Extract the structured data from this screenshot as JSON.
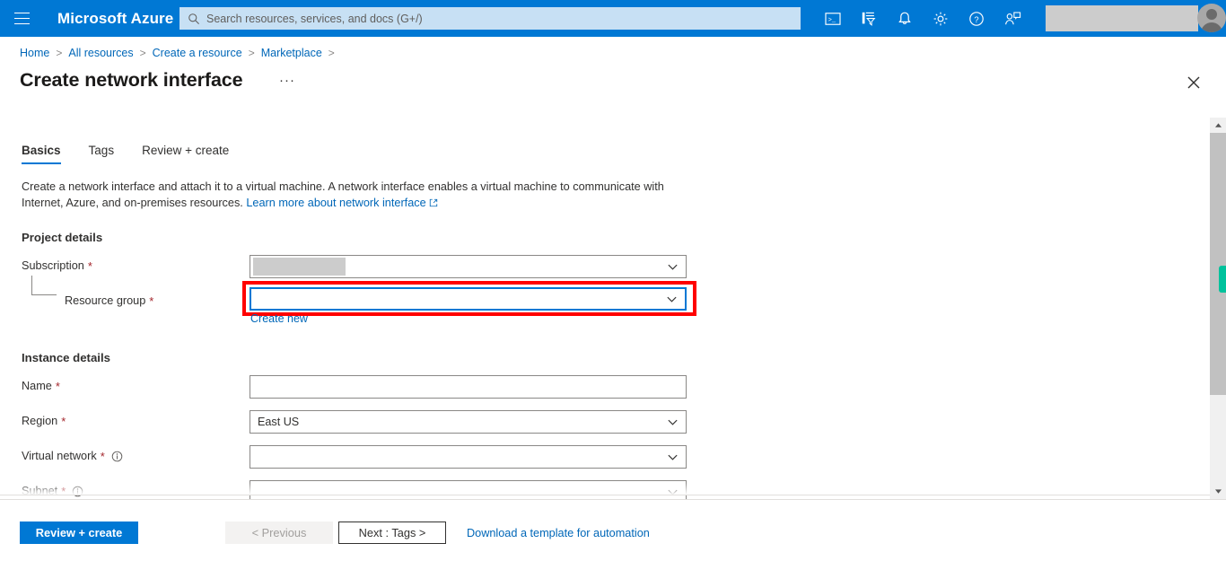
{
  "topbar": {
    "menu_icon": "hamburger-menu-icon",
    "brand": "Microsoft Azure",
    "search": {
      "placeholder": "Search resources, services, and docs (G+/)",
      "value": "",
      "icon": "search-icon"
    },
    "icons": [
      {
        "name": "cloud-shell-icon",
        "label": "Cloud Shell"
      },
      {
        "name": "directories-subscriptions-icon",
        "label": "Directories + subscriptions"
      },
      {
        "name": "notifications-bell-icon",
        "label": "Notifications"
      },
      {
        "name": "settings-gear-icon",
        "label": "Settings"
      },
      {
        "name": "help-question-icon",
        "label": "Help"
      },
      {
        "name": "feedback-person-icon",
        "label": "Feedback"
      }
    ],
    "account_redacted": "",
    "avatar": "user-avatar"
  },
  "breadcrumb": {
    "items": [
      "Home",
      "All resources",
      "Create a resource",
      "Marketplace"
    ],
    "separator": ">"
  },
  "page": {
    "title": "Create network interface",
    "more_actions": "···",
    "close_icon": "close-icon"
  },
  "tabs": [
    {
      "label": "Basics",
      "active": true
    },
    {
      "label": "Tags",
      "active": false
    },
    {
      "label": "Review + create",
      "active": false
    }
  ],
  "description": {
    "text": "Create a network interface and attach it to a virtual machine. A network interface enables a virtual machine to communicate with Internet, Azure, and on-premises resources.",
    "link": "Learn more about network interface",
    "link_icon": "external-link-icon"
  },
  "project_details": {
    "heading": "Project details",
    "fields": [
      {
        "label": "Subscription",
        "required": true,
        "type": "dropdown",
        "value": "",
        "redacted": true,
        "icon": "chevron-down-icon"
      },
      {
        "label": "Resource group",
        "required": true,
        "type": "dropdown",
        "value": "",
        "focused": true,
        "highlighted": true,
        "icon": "chevron-down-icon"
      }
    ],
    "create_new_link": "Create new"
  },
  "instance_details": {
    "heading": "Instance details",
    "fields": [
      {
        "label": "Name",
        "required": true,
        "type": "text",
        "value": "",
        "info": false
      },
      {
        "label": "Region",
        "required": true,
        "type": "dropdown",
        "value": "East US",
        "info": false,
        "icon": "chevron-down-icon"
      },
      {
        "label": "Virtual network",
        "required": true,
        "type": "dropdown",
        "value": "",
        "info": true,
        "info_icon": "info-icon",
        "icon": "chevron-down-icon"
      },
      {
        "label": "Subnet",
        "required": true,
        "type": "dropdown",
        "value": "",
        "info": true,
        "info_icon": "info-icon",
        "icon": "chevron-down-icon"
      }
    ]
  },
  "scrollbar": {
    "up_icon": "scroll-up-arrow-icon",
    "down_icon": "scroll-down-arrow-icon",
    "marker_color": "#00c29c"
  },
  "footer": {
    "review_create": "Review + create",
    "previous": "< Previous",
    "next": "Next : Tags >",
    "download_template": "Download a template for automation"
  },
  "colors": {
    "azure_blue": "#0078d4",
    "link_blue": "#0067b8",
    "required_red": "#a4262c",
    "annotation_red": "#ff0000",
    "marker_green": "#00c29c"
  }
}
